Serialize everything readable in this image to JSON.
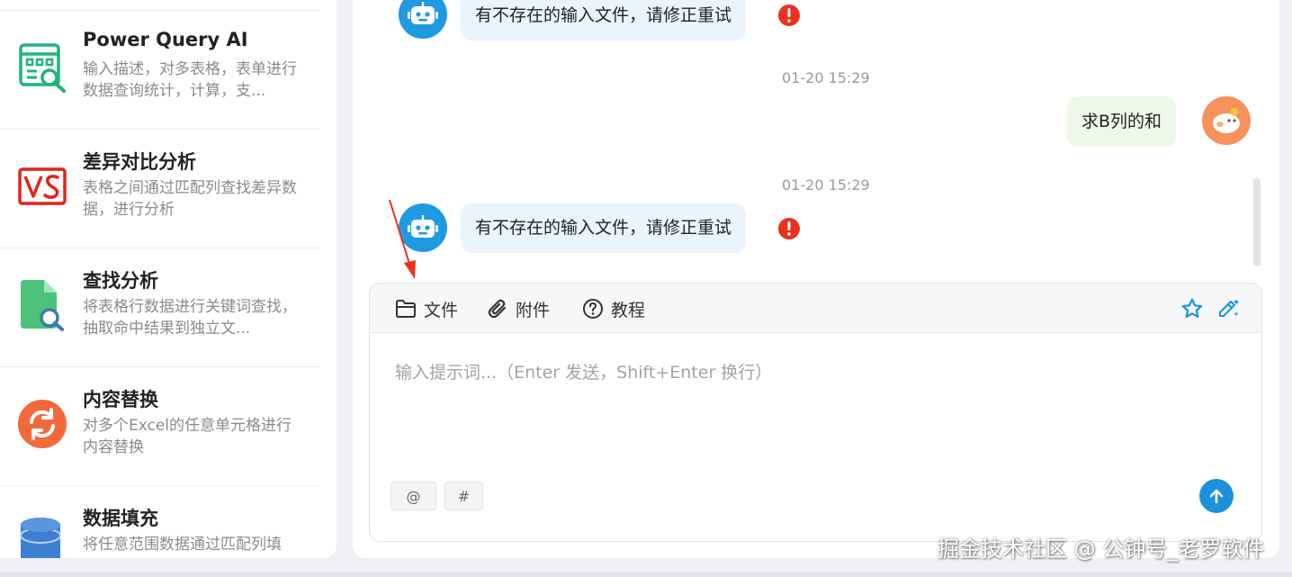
{
  "tools": [
    {
      "title": "Power Query AI",
      "desc": "输入描述，对多表格，表单进行数据查询统计，计算，支...",
      "icon": "power-query-icon"
    },
    {
      "title": "差异对比分析",
      "desc": "表格之间通过匹配列查找差异数据，进行分析",
      "icon": "vs-compare-icon"
    },
    {
      "title": "查找分析",
      "desc": "将表格行数据进行关键词查找，抽取命中结果到独立文...",
      "icon": "file-search-icon"
    },
    {
      "title": "内容替换",
      "desc": "对多个Excel的任意单元格进行内容替换",
      "icon": "refresh-icon"
    },
    {
      "title": "数据填充",
      "desc": "将任意范围数据通过匹配列填",
      "icon": "database-icon"
    }
  ],
  "chat": {
    "messages": [
      {
        "role": "bot",
        "text": "有不存在的输入文件，请修正重试",
        "status": "error"
      },
      {
        "role": "time",
        "text": "01-20 15:29"
      },
      {
        "role": "user",
        "text": "求B列的和"
      },
      {
        "role": "time",
        "text": "01-20 15:29"
      },
      {
        "role": "bot",
        "text": "有不存在的输入文件，请修正重试",
        "status": "error"
      }
    ]
  },
  "composer": {
    "toolbar": {
      "file": "文件",
      "attachment": "附件",
      "tutorial": "教程"
    },
    "placeholder": "输入提示词...（Enter 发送，Shift+Enter 换行）",
    "chip_at": "@",
    "chip_hash": "#"
  },
  "watermark": "掘金技术社区 @ 公钟号_老罗软件",
  "colors": {
    "accent": "#1c92dc",
    "error": "#e8321f",
    "bot_bubble": "#eaf4fd",
    "user_bubble": "#eef8e8"
  }
}
